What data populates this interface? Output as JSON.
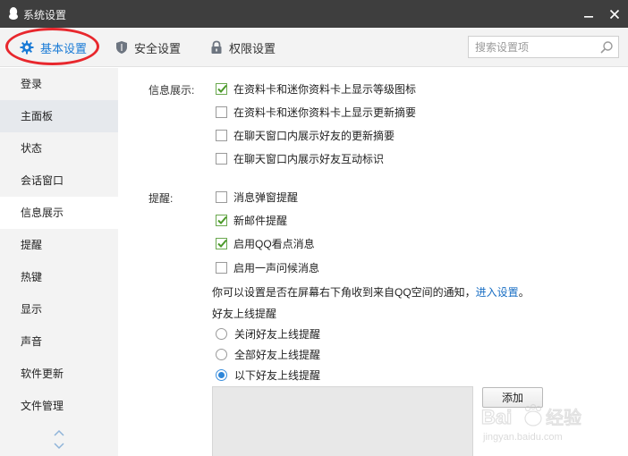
{
  "window": {
    "title": "系统设置"
  },
  "tabs": [
    {
      "label": "基本设置",
      "icon": "gear-icon",
      "active": true
    },
    {
      "label": "安全设置",
      "icon": "shield-icon",
      "active": false
    },
    {
      "label": "权限设置",
      "icon": "lock-icon",
      "active": false
    }
  ],
  "search": {
    "placeholder": "搜索设置项"
  },
  "sidebar": {
    "items": [
      {
        "label": "登录"
      },
      {
        "label": "主面板"
      },
      {
        "label": "状态"
      },
      {
        "label": "会话窗口"
      },
      {
        "label": "信息展示"
      },
      {
        "label": "提醒"
      },
      {
        "label": "热键"
      },
      {
        "label": "显示"
      },
      {
        "label": "声音"
      },
      {
        "label": "软件更新"
      },
      {
        "label": "文件管理"
      }
    ],
    "active": "信息展示"
  },
  "info_display": {
    "label": "信息展示:",
    "options": [
      {
        "label": "在资料卡和迷你资料卡上显示等级图标",
        "checked": true
      },
      {
        "label": "在资料卡和迷你资料卡上显示更新摘要",
        "checked": false
      },
      {
        "label": "在聊天窗口内展示好友的更新摘要",
        "checked": false
      },
      {
        "label": "在聊天窗口内展示好友互动标识",
        "checked": false
      }
    ]
  },
  "reminder": {
    "label": "提醒:",
    "options": [
      {
        "label": "消息弹窗提醒",
        "checked": false
      },
      {
        "label": "新邮件提醒",
        "checked": true
      },
      {
        "label": "启用QQ看点消息",
        "checked": true
      },
      {
        "label": "启用一声问候消息",
        "checked": false
      }
    ],
    "note_text": "你可以设置是否在屏幕右下角收到来自QQ空间的通知，",
    "note_link": "进入设置",
    "note_end": "。",
    "friend_online_title": "好友上线提醒",
    "friend_online_options": [
      {
        "label": "关闭好友上线提醒",
        "selected": false
      },
      {
        "label": "全部好友上线提醒",
        "selected": false
      },
      {
        "label": "以下好友上线提醒",
        "selected": true
      }
    ],
    "add_button": "添加"
  },
  "watermark": {
    "brand": "Bai",
    "brand_suffix": "经验",
    "url": "jingyan.baidu.com"
  },
  "colors": {
    "titlebar": "#3e3e3e",
    "accent": "#1a7bd6",
    "check_green": "#4c9a2a",
    "highlight_ring": "#e8272d"
  }
}
